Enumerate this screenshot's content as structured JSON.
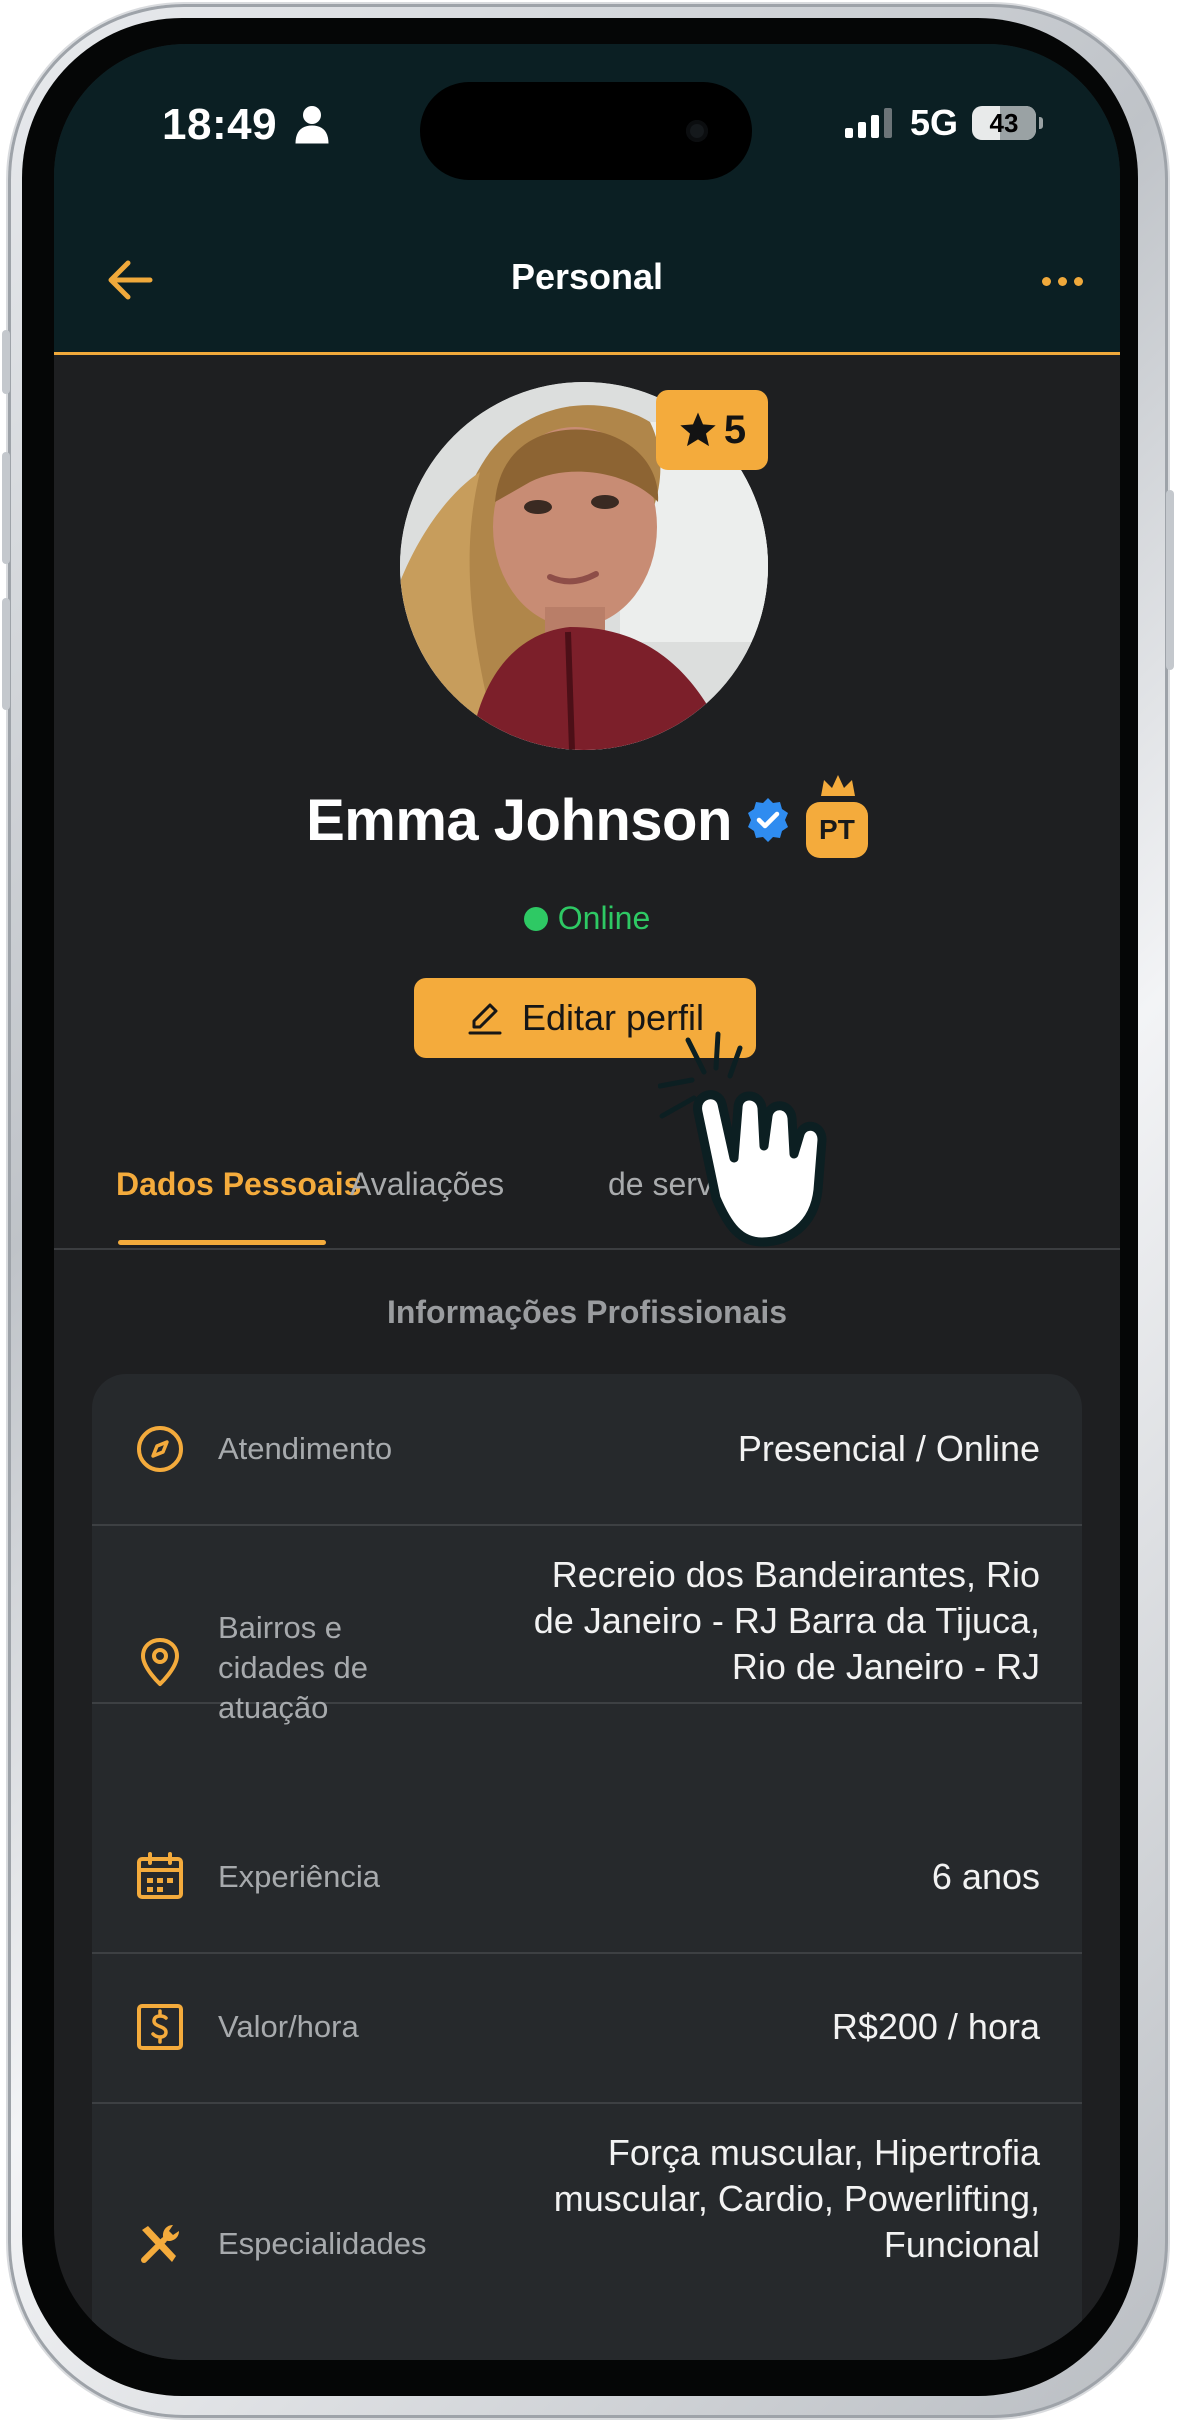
{
  "status_bar": {
    "time": "18:49",
    "network": "5G",
    "battery": "43",
    "battery_level": 0.43
  },
  "nav": {
    "title": "Personal",
    "back_icon": "arrow-left-icon",
    "more_icon": "more-horizontal-icon"
  },
  "profile": {
    "name": "Emma Johnson",
    "rating": "5",
    "role_badge": "PT",
    "status": "Online",
    "edit_label": "Editar perfil",
    "verified": true
  },
  "tabs": [
    {
      "label": "Dados Pessoais",
      "active": true
    },
    {
      "label": "Avaliações",
      "active": false
    },
    {
      "label": "de serviço",
      "active": false
    }
  ],
  "section": {
    "title": "Informações Profissionais"
  },
  "info_rows": [
    {
      "icon": "compass-icon",
      "label": "Atendimento",
      "value": "Presencial / Online"
    },
    {
      "icon": "map-pin-icon",
      "label": "Bairros e cidades de atuação",
      "value": "Recreio dos Bandeirantes, Rio de Janeiro - RJ Barra da Tijuca, Rio de Janeiro - RJ"
    },
    {
      "icon": "calendar-icon",
      "label": "Experiência",
      "value": "6 anos"
    },
    {
      "icon": "dollar-icon",
      "label": "Valor/hora",
      "value": "R$200 / hora"
    },
    {
      "icon": "tools-icon",
      "label": "Especialidades",
      "value": "Força muscular, Hipertrofia muscular, Cardio, Powerlifting, Funcional"
    }
  ],
  "colors": {
    "accent": "#f4ab3c",
    "online": "#2ec964",
    "header_bg": "#0b1f23",
    "screen_bg": "#1e1f21",
    "card_bg": "#26292c"
  }
}
